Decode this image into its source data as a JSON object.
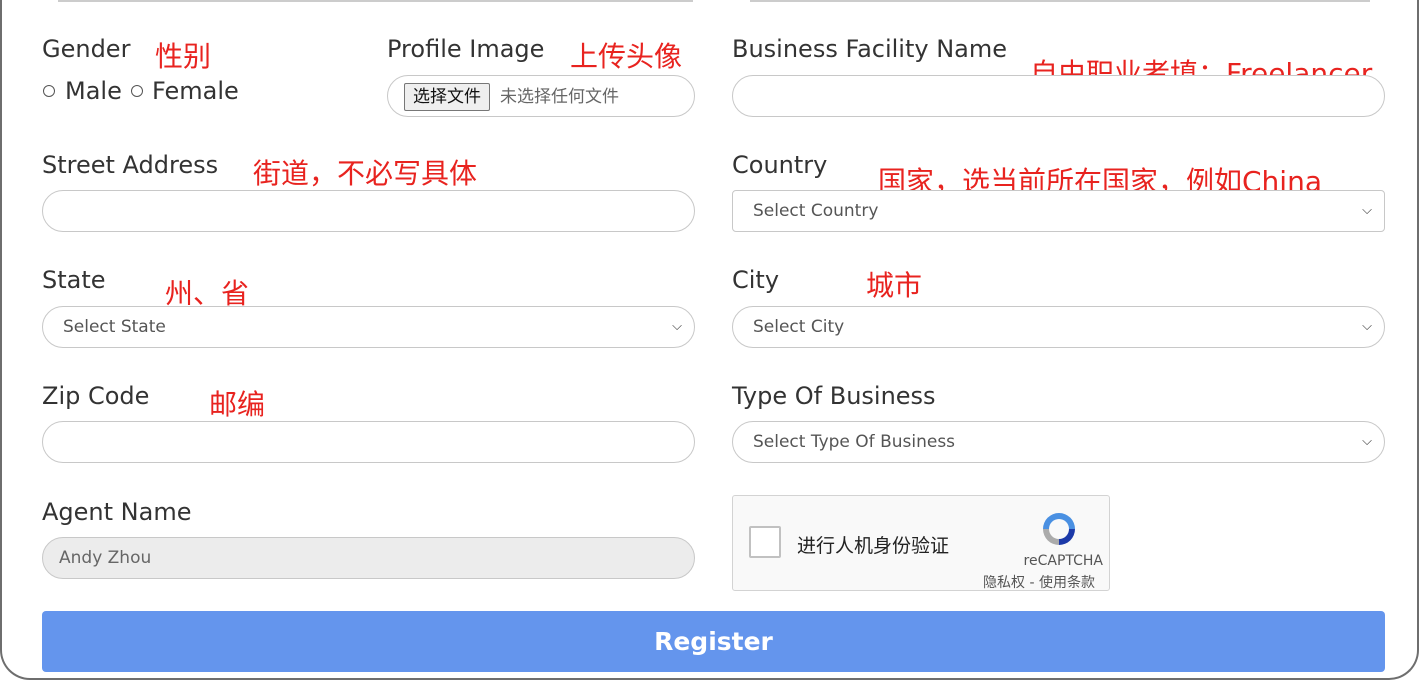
{
  "gender": {
    "label": "Gender",
    "note": "性别",
    "options": [
      "Male",
      "Female"
    ]
  },
  "profile_image": {
    "label": "Profile Image",
    "note": "上传头像",
    "button_label": "选择文件",
    "status": "未选择任何文件"
  },
  "business_facility": {
    "label": "Business Facility Name",
    "note": "自由职业者填：Freelancer",
    "value": ""
  },
  "street_address": {
    "label": "Street Address",
    "note": "街道，不必写具体",
    "value": ""
  },
  "country": {
    "label": "Country",
    "note": "国家，选当前所在国家，例如China",
    "selected": "Select Country"
  },
  "state": {
    "label": "State",
    "note": "州、省",
    "selected": "Select State"
  },
  "city": {
    "label": "City",
    "note": "城市",
    "selected": "Select City"
  },
  "zip_code": {
    "label": "Zip Code",
    "note": "邮编",
    "value": ""
  },
  "type_of_business": {
    "label": "Type Of Business",
    "selected": "Select Type Of Business"
  },
  "agent_name": {
    "label": "Agent Name",
    "value": "Andy Zhou"
  },
  "captcha": {
    "text": "进行人机身份验证",
    "brand": "reCAPTCHA",
    "links": "隐私权 - 使用条款"
  },
  "register_label": "Register",
  "colors": {
    "annotation": "#e8231f",
    "register_button": "#6495ed"
  }
}
